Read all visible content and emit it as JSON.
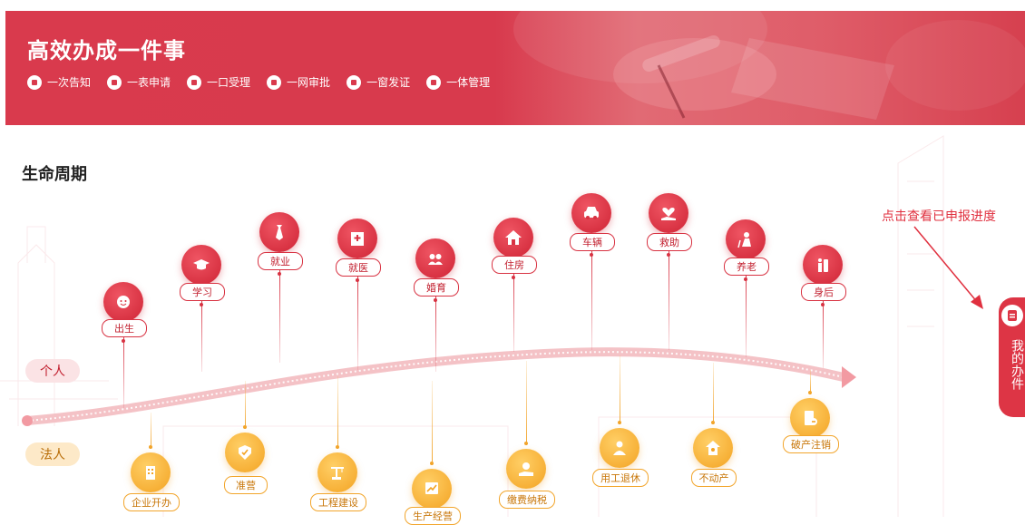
{
  "banner": {
    "title": "高效办成一件事",
    "features": [
      {
        "label": "一次告知",
        "icon": "notice-icon"
      },
      {
        "label": "一表申请",
        "icon": "form-icon"
      },
      {
        "label": "一口受理",
        "icon": "inbox-icon"
      },
      {
        "label": "一网审批",
        "icon": "user-icon"
      },
      {
        "label": "一窗发证",
        "icon": "certificate-icon"
      },
      {
        "label": "一体管理",
        "icon": "manage-icon"
      }
    ]
  },
  "section_title": "生命周期",
  "progress_hint": "点击查看已申报进度",
  "side_tab": {
    "label": "我的办件",
    "icon": "document-icon"
  },
  "tracks": {
    "personal": "个人",
    "corporate": "法人"
  },
  "personal_items": [
    {
      "label": "出生",
      "icon": "baby-icon"
    },
    {
      "label": "学习",
      "icon": "graduation-cap-icon"
    },
    {
      "label": "就业",
      "icon": "tie-icon"
    },
    {
      "label": "就医",
      "icon": "hospital-icon"
    },
    {
      "label": "婚育",
      "icon": "couple-icon"
    },
    {
      "label": "住房",
      "icon": "house-icon"
    },
    {
      "label": "车辆",
      "icon": "car-icon"
    },
    {
      "label": "救助",
      "icon": "heart-hand-icon"
    },
    {
      "label": "养老",
      "icon": "elderly-icon"
    },
    {
      "label": "身后",
      "icon": "memorial-icon"
    }
  ],
  "corporate_items": [
    {
      "label": "企业开办",
      "icon": "building-icon"
    },
    {
      "label": "准营",
      "icon": "badge-icon"
    },
    {
      "label": "工程建设",
      "icon": "crane-icon"
    },
    {
      "label": "生产经营",
      "icon": "chart-icon"
    },
    {
      "label": "缴费纳税",
      "icon": "coin-hand-icon"
    },
    {
      "label": "用工退休",
      "icon": "worker-icon"
    },
    {
      "label": "不动产",
      "icon": "property-icon"
    },
    {
      "label": "破产注销",
      "icon": "cancel-doc-icon"
    }
  ],
  "colors": {
    "primary": "#d93a4d",
    "personal": "#d83242",
    "corporate": "#f2a52b"
  }
}
